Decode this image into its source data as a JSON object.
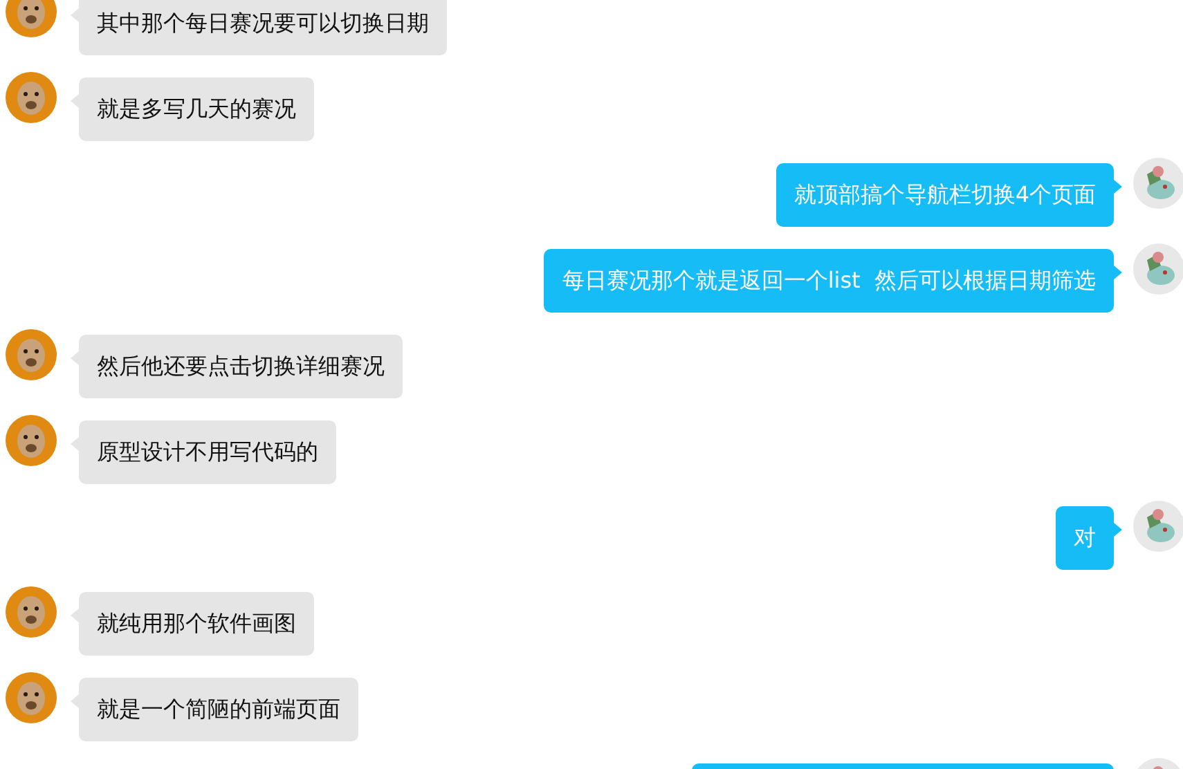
{
  "messages": [
    {
      "kind": "incoming",
      "text": "其中那个每日赛况要可以切换日期"
    },
    {
      "kind": "incoming",
      "text": "就是多写几天的赛况"
    },
    {
      "kind": "outgoing",
      "text": "就顶部搞个导航栏切换4个页面"
    },
    {
      "kind": "outgoing",
      "text": "每日赛况那个就是返回一个list  然后可以根据日期筛选"
    },
    {
      "kind": "incoming",
      "text": "然后他还要点击切换详细赛况"
    },
    {
      "kind": "incoming",
      "text": "原型设计不用写代码的"
    },
    {
      "kind": "outgoing",
      "text": "对"
    },
    {
      "kind": "incoming",
      "text": "就纯用那个软件画图"
    },
    {
      "kind": "incoming",
      "text": "就是一个简陋的前端页面"
    },
    {
      "kind": "outgoing"
    }
  ]
}
